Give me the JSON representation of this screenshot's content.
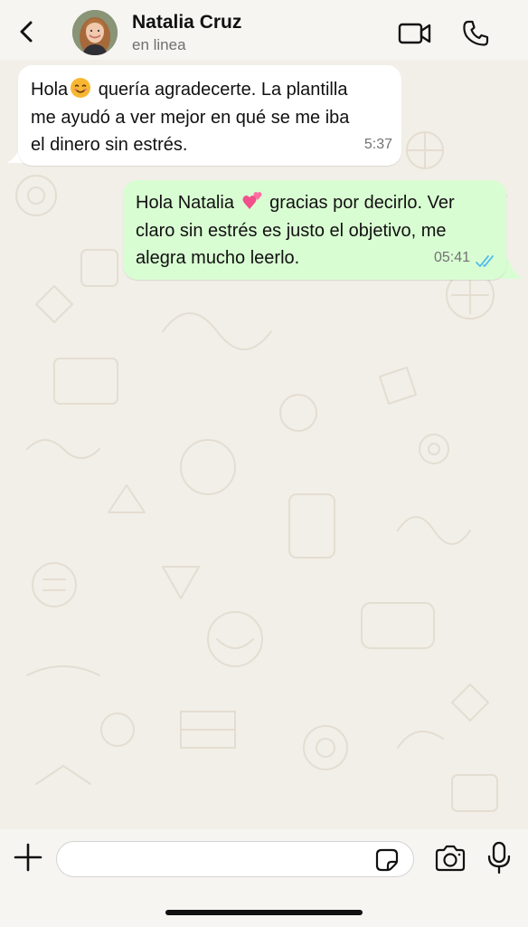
{
  "header": {
    "contact_name": "Natalia Cruz",
    "status": "en linea",
    "icons": {
      "back": "back-arrow-icon",
      "video": "video-camera-icon",
      "call": "phone-icon"
    }
  },
  "messages": [
    {
      "direction": "incoming",
      "lines": [
        {
          "before": "Hola",
          "emoji": "smiling-face-emoji",
          "after": " quería agradecerte. La plantilla"
        },
        {
          "text": "me ayudó a ver mejor en qué se me iba"
        },
        {
          "text": "el dinero sin estrés."
        }
      ],
      "time": "5:37"
    },
    {
      "direction": "outgoing",
      "lines": [
        {
          "before": "Hola Natalia ",
          "emoji": "two-hearts-emoji",
          "after": " gracias por decirlo. Ver"
        },
        {
          "text": "claro sin estrés es justo el objetivo, me"
        },
        {
          "text": "alegra mucho leerlo."
        }
      ],
      "time": "05:41",
      "status": "read"
    }
  ],
  "composer": {
    "value": "",
    "icons": {
      "attach": "plus-icon",
      "sticker": "sticker-icon",
      "camera": "camera-icon",
      "mic": "microphone-icon"
    }
  },
  "colors": {
    "incoming_bubble": "#ffffff",
    "outgoing_bubble": "#d9fdd3",
    "read_ticks": "#53bdeb",
    "wallpaper": "#f2efe8"
  }
}
